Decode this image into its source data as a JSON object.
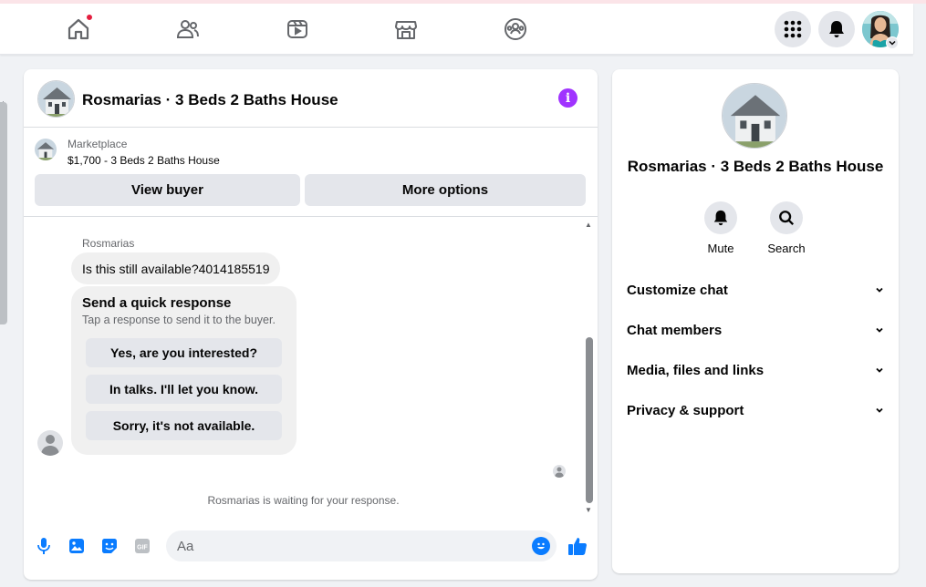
{
  "nav": {
    "home_icon": "home-icon",
    "friends_icon": "friends-icon",
    "watch_icon": "video-icon",
    "marketplace_icon": "marketplace-icon",
    "groups_icon": "groups-icon",
    "menu_icon": "grid-menu-icon",
    "notifications_icon": "bell-icon",
    "notification_dot_color": "#e41e3f"
  },
  "chat": {
    "title": "Rosmarias · 3 Beds 2 Baths House",
    "marketplace_label": "Marketplace",
    "listing": "$1,700 - 3 Beds 2 Baths House",
    "view_buyer_label": "View buyer",
    "more_options_label": "More options",
    "sender_name": "Rosmarias",
    "message": "Is this still available?4014185519",
    "quick_response": {
      "title": "Send a quick response",
      "subtitle": "Tap a response to send it to the buyer.",
      "options": [
        "Yes, are you interested?",
        "In talks. I'll let you know.",
        "Sorry, it's not available."
      ]
    },
    "waiting_text": "Rosmarias is waiting for your response.",
    "composer_placeholder": "Aa",
    "accent_color": "#0a7cff",
    "info_color": "#a033ff"
  },
  "info_panel": {
    "title": "Rosmarias · 3 Beds 2 Baths House",
    "actions": [
      {
        "label": "Mute",
        "icon": "bell-icon"
      },
      {
        "label": "Search",
        "icon": "search-icon"
      }
    ],
    "sections": [
      "Customize chat",
      "Chat members",
      "Media, files and links",
      "Privacy & support"
    ]
  }
}
